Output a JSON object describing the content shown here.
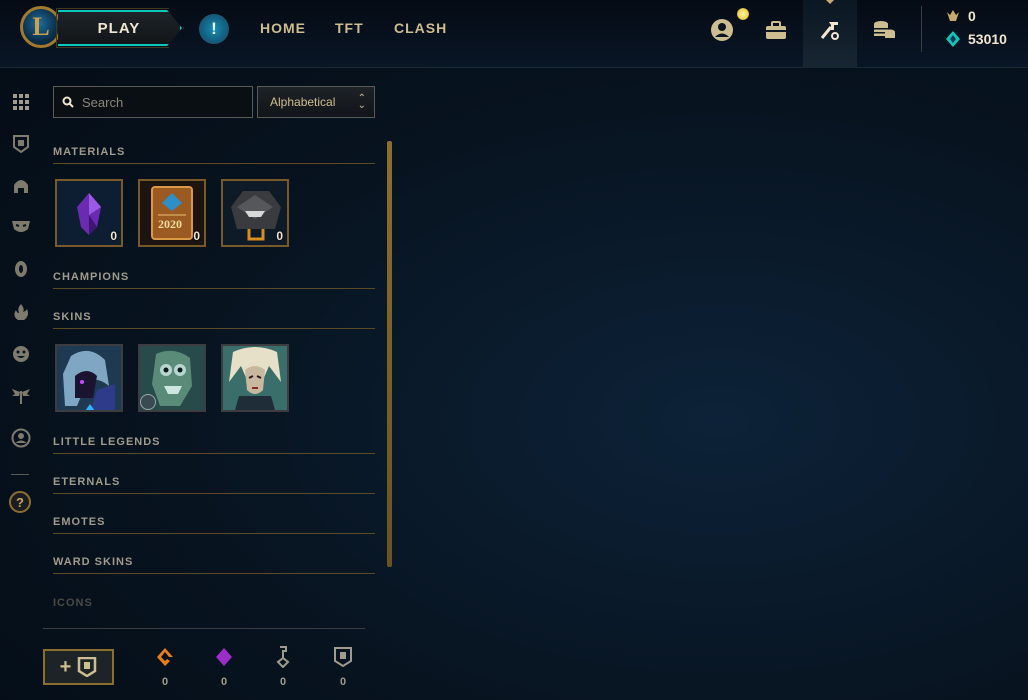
{
  "topbar": {
    "logo_letter": "L",
    "play_label": "PLAY",
    "alert_glyph": "!",
    "nav": [
      "HOME",
      "TFT",
      "CLASH"
    ],
    "icons": [
      "profile-icon",
      "collection-icon",
      "loot-icon",
      "store-icon"
    ],
    "currency": [
      {
        "icon": "riot-points-icon",
        "value": "0",
        "color": "#c8aa6e"
      },
      {
        "icon": "blue-essence-icon",
        "value": "53010",
        "color": "#0ac8b9"
      }
    ]
  },
  "sidebar": {
    "icons": [
      "grid-icon",
      "emblem-icon",
      "helmet-icon",
      "mask-icon",
      "ward-icon",
      "fire-icon",
      "emote-icon",
      "wings-icon",
      "profile-circle-icon"
    ],
    "help_glyph": "?"
  },
  "filters": {
    "search_placeholder": "Search",
    "sort_value": "Alphabetical"
  },
  "sections": {
    "materials": {
      "title": "MATERIALS",
      "items": [
        {
          "name": "mythic-essence",
          "count": "0"
        },
        {
          "name": "event-pass-2020",
          "label": "2020",
          "count": "0"
        },
        {
          "name": "hextech-chest",
          "count": "0"
        }
      ]
    },
    "champions": {
      "title": "CHAMPIONS"
    },
    "skins": {
      "title": "SKINS",
      "items": [
        {
          "name": "skin-1"
        },
        {
          "name": "skin-2"
        },
        {
          "name": "skin-3"
        }
      ]
    },
    "little_legends": {
      "title": "LITTLE LEGENDS"
    },
    "eternals": {
      "title": "ETERNALS"
    },
    "emotes": {
      "title": "EMOTES"
    },
    "ward_skins": {
      "title": "WARD SKINS"
    },
    "icons": {
      "title": "ICONS"
    }
  },
  "footer": {
    "craft_plus": "+",
    "wallet": [
      {
        "icon": "orange-essence-icon",
        "value": "0",
        "color": "#e87d1e"
      },
      {
        "icon": "mythic-essence-icon",
        "value": "0",
        "color": "#9b2ec6"
      },
      {
        "icon": "key-icon",
        "value": "0",
        "color": "#a09b8c"
      },
      {
        "icon": "emblem-icon",
        "value": "0",
        "color": "#a09b8c"
      }
    ]
  },
  "colors": {
    "gold": "#c8aa6e",
    "teal": "#0ac8b9",
    "background": "#07131f"
  }
}
